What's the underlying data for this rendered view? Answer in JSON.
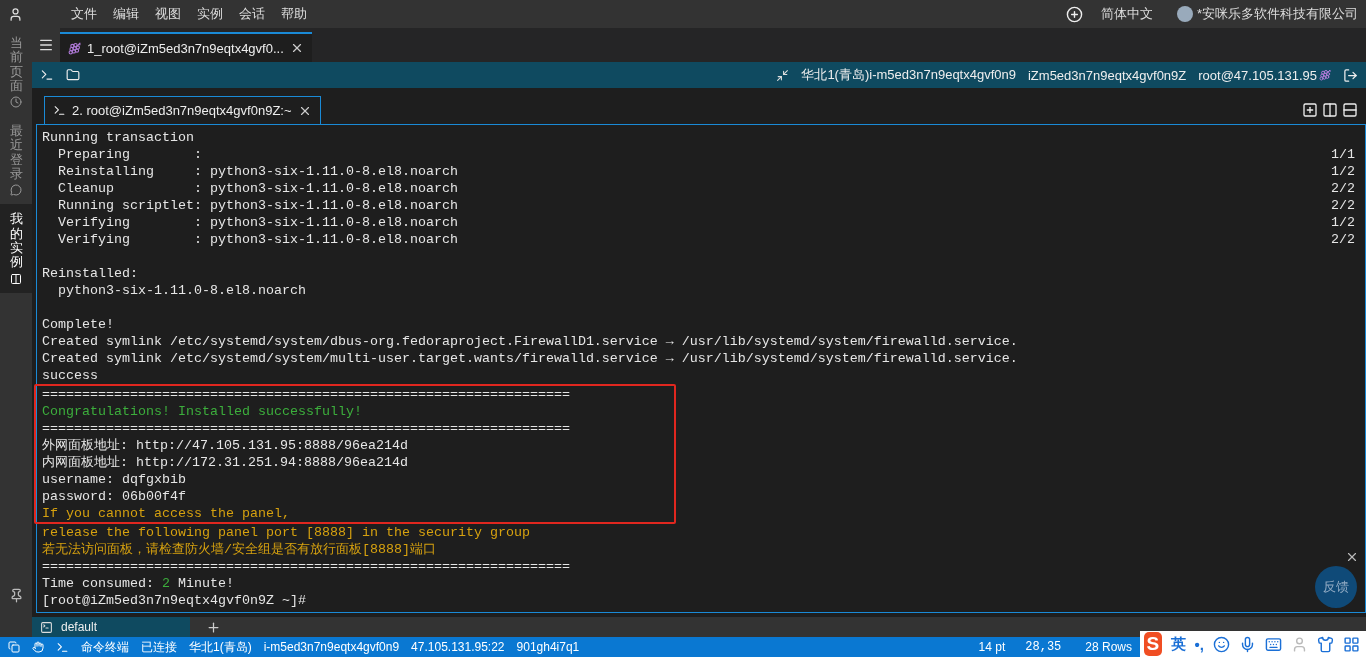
{
  "menubar": {
    "menus": [
      "文件",
      "编辑",
      "视图",
      "实例",
      "会话",
      "帮助"
    ],
    "language": "简体中文",
    "account": "*安咪乐多软件科技有限公司"
  },
  "sidebar": {
    "items": [
      {
        "label": "当前页面",
        "kind": "page",
        "selected": false
      },
      {
        "label": "最近登录",
        "kind": "recent",
        "selected": false
      },
      {
        "label": "我的实例",
        "kind": "instances",
        "selected": true
      }
    ]
  },
  "session_tabs": [
    {
      "label": "1_root@iZm5ed3n7n9eqtx4gvf0...",
      "selected": true
    }
  ],
  "toolbar": {
    "region_instance": "华北1(青岛)i-m5ed3n7n9eqtx4gvf0n9",
    "hostname": "iZm5ed3n7n9eqtx4gvf0n9Z",
    "login": "root@47.105.131.95"
  },
  "terminal_tabs": [
    {
      "label": "2. root@iZm5ed3n7n9eqtx4gvf0n9Z:~",
      "selected": true
    }
  ],
  "terminal": {
    "blocks": [
      {
        "kind": "plain",
        "lines": [
          {
            "kind": "text",
            "text": "Running transaction"
          },
          {
            "kind": "text",
            "text": "  Preparing        :",
            "right": "1/1"
          },
          {
            "kind": "text",
            "text": "  Reinstalling     : python3-six-1.11.0-8.el8.noarch",
            "right": "1/2"
          },
          {
            "kind": "text",
            "text": "  Cleanup          : python3-six-1.11.0-8.el8.noarch",
            "right": "2/2"
          },
          {
            "kind": "text",
            "text": "  Running scriptlet: python3-six-1.11.0-8.el8.noarch",
            "right": "2/2"
          },
          {
            "kind": "text",
            "text": "  Verifying        : python3-six-1.11.0-8.el8.noarch",
            "right": "1/2"
          },
          {
            "kind": "text",
            "text": "  Verifying        : python3-six-1.11.0-8.el8.noarch",
            "right": "2/2"
          },
          {
            "kind": "blank"
          },
          {
            "kind": "text",
            "text": "Reinstalled:"
          },
          {
            "kind": "text",
            "text": "  python3-six-1.11.0-8.el8.noarch"
          },
          {
            "kind": "blank"
          },
          {
            "kind": "text",
            "text": "Complete!"
          },
          {
            "kind": "text",
            "text": "Created symlink /etc/systemd/system/dbus-org.fedoraproject.FirewallD1.service → /usr/lib/systemd/system/firewalld.service."
          },
          {
            "kind": "text",
            "text": "Created symlink /etc/systemd/system/multi-user.target.wants/firewalld.service → /usr/lib/systemd/system/firewalld.service."
          },
          {
            "kind": "text",
            "text": "success"
          }
        ]
      },
      {
        "kind": "highlighted",
        "lines": [
          {
            "kind": "text",
            "text": "=================================================================="
          },
          {
            "kind": "text",
            "text": "Congratulations! Installed successfully!",
            "color": "#3cae3c"
          },
          {
            "kind": "text",
            "text": "=================================================================="
          },
          {
            "kind": "text",
            "text": "外网面板地址: http://47.105.131.95:8888/96ea214d"
          },
          {
            "kind": "text",
            "text": "内网面板地址: http://172.31.251.94:8888/96ea214d"
          },
          {
            "kind": "text",
            "text": "username: dqfgxbib"
          },
          {
            "kind": "text",
            "text": "password: 06b00f4f"
          },
          {
            "kind": "text",
            "text": "If you cannot access the panel,",
            "color": "#d6a10f"
          }
        ]
      },
      {
        "kind": "plain",
        "lines": [
          {
            "kind": "text",
            "text": "release the following panel port [8888] in the security group",
            "color": "#d6a10f"
          },
          {
            "kind": "text",
            "text": "若无法访问面板，请检查防火墙/安全组是否有放行面板[8888]端口",
            "color": "#d6a10f"
          },
          {
            "kind": "text",
            "text": "=================================================================="
          },
          {
            "kind": "mixed",
            "segments": [
              {
                "text": "Time consumed: "
              },
              {
                "text": "2",
                "color": "#3cae3c"
              },
              {
                "text": " Minute!"
              }
            ]
          },
          {
            "kind": "text",
            "text": "[root@iZm5ed3n7n9eqtx4gvf0n9Z ~]#"
          }
        ]
      }
    ]
  },
  "feedback": {
    "label": "反馈"
  },
  "bottom_tabs": [
    {
      "label": "default",
      "selected": true
    }
  ],
  "status_bar": {
    "left": [
      "命令终端",
      "已连接",
      "华北1(青岛)",
      "i-m5ed3n7n9eqtx4gvf0n9",
      "47.105.131.95:22",
      "901gh4i7q1"
    ],
    "font_size": "14 pt",
    "cursor": "28,35",
    "rows": "28 Rows"
  },
  "ime_bar": {
    "logo": "S",
    "mode": "英",
    "punctuation": "•,"
  }
}
